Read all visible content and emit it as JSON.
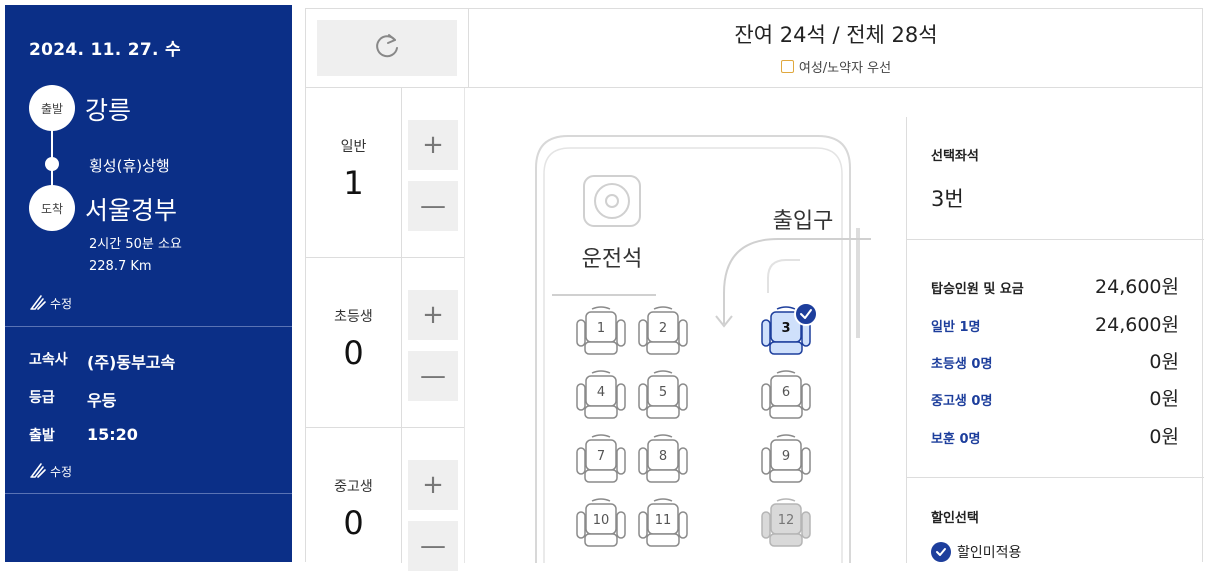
{
  "trip": {
    "date": "2024. 11. 27. 수",
    "departure_badge": "출발",
    "departure_city": "강릉",
    "via": "횡성(휴)상행",
    "arrival_badge": "도착",
    "arrival_city": "서울경부",
    "duration": "2시간 50분 소요",
    "distance": "228.7 Km",
    "edit_label": "수정"
  },
  "bus_info": {
    "company_label": "고속사",
    "company_value": "(주)동부고속",
    "grade_label": "등급",
    "grade_value": "우등",
    "depart_label": "출발",
    "depart_value": "15:20",
    "edit_label": "수정"
  },
  "header": {
    "seat_count": "잔여 24석 / 전체 28석",
    "priority_label": "여성/노약자 우선"
  },
  "counters": [
    {
      "label": "일반",
      "value": "1"
    },
    {
      "label": "초등생",
      "value": "0"
    },
    {
      "label": "중고생",
      "value": "0"
    }
  ],
  "bus_layout": {
    "driver_label": "운전석",
    "entrance_label": "출입구",
    "seats": [
      {
        "number": "1",
        "state": "available"
      },
      {
        "number": "2",
        "state": "available"
      },
      {
        "number": "3",
        "state": "selected"
      },
      {
        "number": "4",
        "state": "available"
      },
      {
        "number": "5",
        "state": "available"
      },
      {
        "number": "6",
        "state": "available"
      },
      {
        "number": "7",
        "state": "available"
      },
      {
        "number": "8",
        "state": "available"
      },
      {
        "number": "9",
        "state": "available"
      },
      {
        "number": "10",
        "state": "available"
      },
      {
        "number": "11",
        "state": "available"
      },
      {
        "number": "12",
        "state": "reserved"
      }
    ]
  },
  "summary": {
    "selected_seat_title": "선택좌석",
    "selected_seat_value": "3번",
    "fare_title": "탑승인원 및 요금",
    "fare_total": "24,600원",
    "rows": [
      {
        "label": "일반 1명",
        "value": "24,600원"
      },
      {
        "label": "초등생 0명",
        "value": "0원"
      },
      {
        "label": "중고생 0명",
        "value": "0원"
      },
      {
        "label": "보훈 0명",
        "value": "0원"
      }
    ],
    "discount_title": "할인선택",
    "discount_option": "할인미적용"
  },
  "colors": {
    "sidebar_bg": "#0b2f87",
    "accent_blue": "#1d3e9c",
    "selected_seat_fill": "#cfe0fb",
    "reserved_seat_fill": "#d9d9d9",
    "priority_box": "#e0a83e"
  }
}
